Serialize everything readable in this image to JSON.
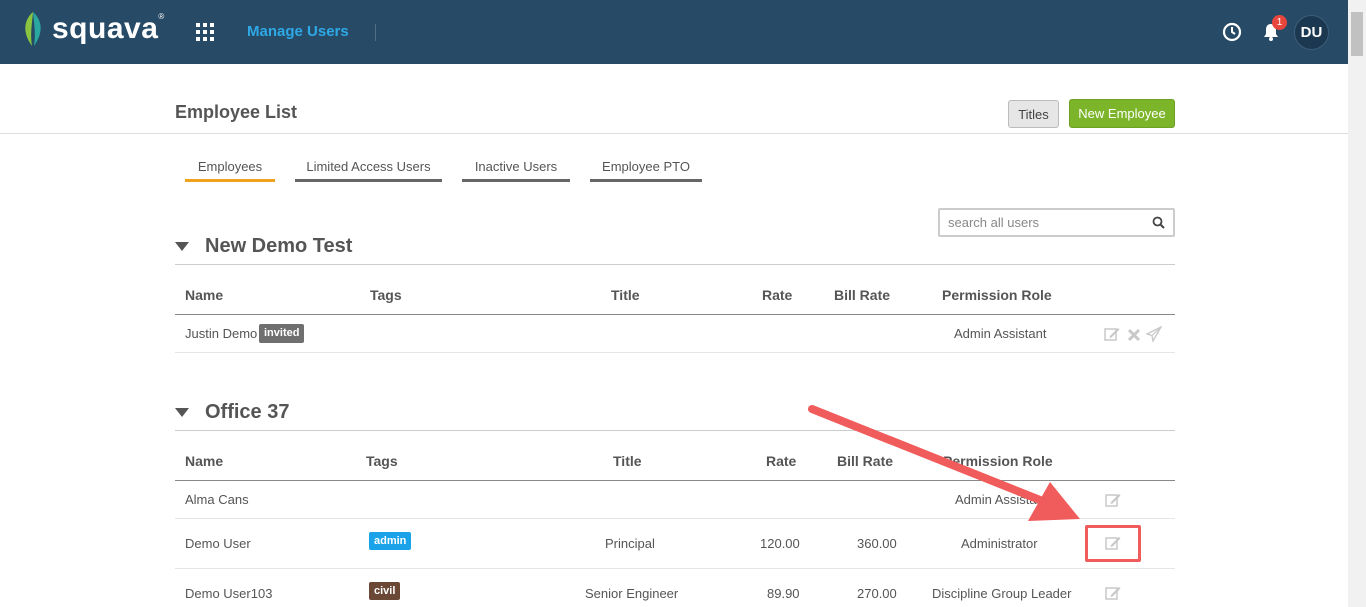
{
  "header": {
    "brand": "squava",
    "brand_mark": "®",
    "app_title": "Manage Users",
    "notification_count": "1",
    "avatar_initials": "DU"
  },
  "page": {
    "title": "Employee List",
    "titles_button": "Titles",
    "new_employee_button": "New Employee"
  },
  "tabs": [
    {
      "label": "Employees",
      "active": true
    },
    {
      "label": "Limited Access Users",
      "active": false
    },
    {
      "label": "Inactive Users",
      "active": false
    },
    {
      "label": "Employee PTO",
      "active": false
    }
  ],
  "search": {
    "placeholder": "search all users"
  },
  "columns": [
    "Name",
    "Tags",
    "Title",
    "Rate",
    "Bill Rate",
    "Permission Role"
  ],
  "groups": [
    {
      "name": "New Demo Test",
      "rows": [
        {
          "name": "Justin Demo",
          "badge": "invited",
          "tag": "",
          "title": "",
          "rate": "",
          "bill_rate": "",
          "role": "Admin Assistant"
        }
      ]
    },
    {
      "name": "Office 37",
      "rows": [
        {
          "name": "Alma Cans",
          "tag": "",
          "title": "",
          "rate": "",
          "bill_rate": "",
          "role": "Admin Assistant"
        },
        {
          "name": "Demo User",
          "tag": "admin",
          "title": "Principal",
          "rate": "120.00",
          "bill_rate": "360.00",
          "role": "Administrator"
        },
        {
          "name": "Demo User103",
          "tag": "civil",
          "title": "Senior Engineer",
          "rate": "89.90",
          "bill_rate": "270.00",
          "role": "Discipline Group Leader"
        }
      ]
    }
  ],
  "colors": {
    "header_bg": "#274b67",
    "accent_blue": "#2ea8e6",
    "new_button_green": "#7cb52a",
    "active_tab_orange": "#f0a21f",
    "annotation_red": "#f05b5b",
    "tag_admin": "#1aa3e8",
    "tag_civil": "#6b4836",
    "tag_invited": "#6f6f6f"
  },
  "icons": {
    "logo": "leaf-logo-icon",
    "apps": "grid-icon",
    "history": "clock-icon",
    "notifications": "bell-icon",
    "search": "search-icon",
    "edit": "edit-icon",
    "delete": "close-icon",
    "resend": "send-icon",
    "collapse": "caret-down-icon"
  }
}
